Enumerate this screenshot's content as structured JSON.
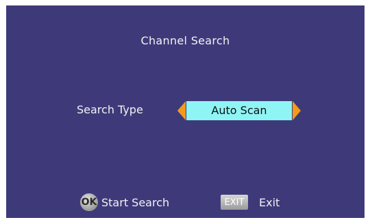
{
  "screen": {
    "title": "Channel Search",
    "search_type": {
      "label": "Search Type",
      "value": "Auto Scan"
    },
    "footer": {
      "ok": {
        "key_label": "OK",
        "action": "Start Search"
      },
      "exit": {
        "key_label": "EXIT",
        "action": "Exit"
      }
    }
  },
  "colors": {
    "background": "#3e3a7a",
    "selection": "#8ff4f4",
    "arrow": "#f39a1c",
    "text": "#f2f2f2"
  }
}
